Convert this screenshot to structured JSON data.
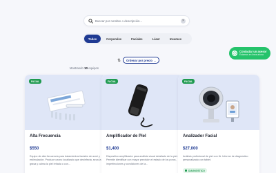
{
  "search": {
    "placeholder": "Buscar por nombre o descripción..."
  },
  "tabs": [
    {
      "label": "Todos"
    },
    {
      "label": "Corporales"
    },
    {
      "label": "Faciales"
    },
    {
      "label": "Láser"
    },
    {
      "label": "Insumos"
    }
  ],
  "whatsapp": {
    "main": "Contactar un asesor",
    "sub": "Estamos en línea ahora"
  },
  "sort": {
    "selected": "Ordenar por precio"
  },
  "showing": {
    "prefix": "Mostrando",
    "count": "10",
    "suffix": "equipos"
  },
  "products": [
    {
      "badge": "FACIAL",
      "title": "Alta Frecuencia",
      "price": "$550",
      "desc": "Equipo de alta frecuencia para tratamientos faciales de acné y estimulación. Produce ozono localizado que desinfecta, seca la grasa y calma la piel irritada o con..."
    },
    {
      "badge": "FACIAL",
      "title": "Amplificador de Piel",
      "price": "$1,400",
      "desc": "Dispositivo amplificador para análisis visual detallado de la piel. Permite identificar con mayor precisión el estado de los poros, imperfecciones y condiciones de la..."
    },
    {
      "badge": "FACIAL",
      "title": "Analizador Facial",
      "price": "$27,000",
      "desc": "Análisis profesional de piel con IA. Informe de diagnóstico personalizado con tablet.",
      "pill": "DIAGNÓSTICO"
    }
  ],
  "colors": {
    "primary": "#1f3a93",
    "accent_green": "#1f9a50",
    "whatsapp": "#25c36b",
    "card_image_bg": "#dfe6f7"
  }
}
